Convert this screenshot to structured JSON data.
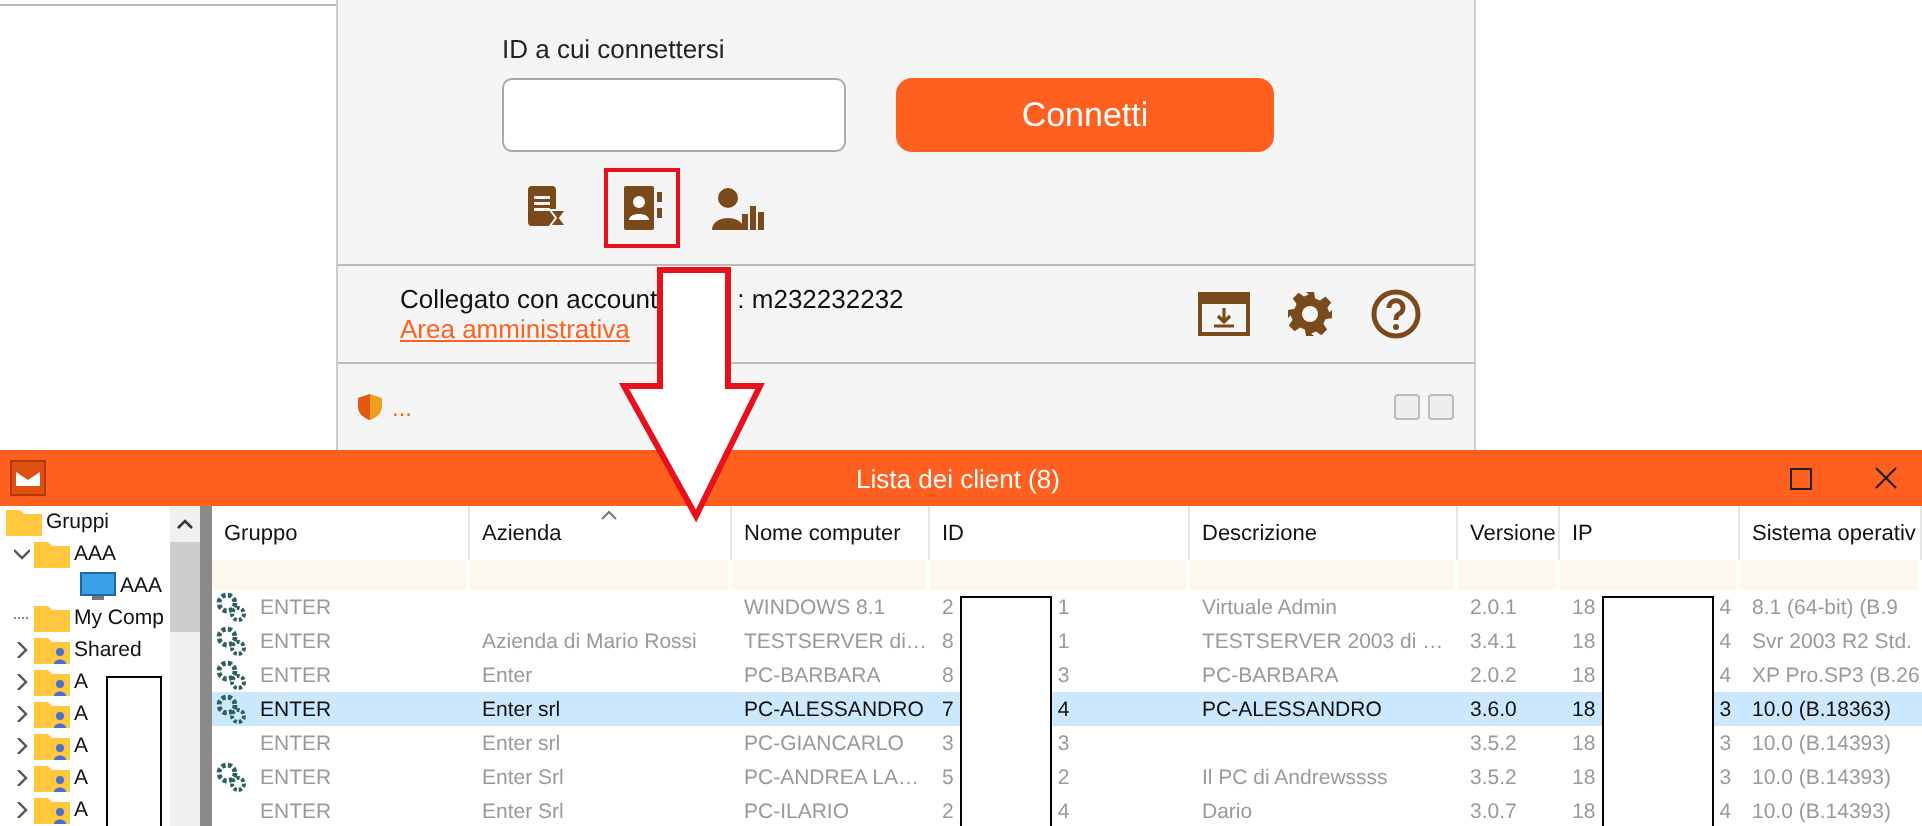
{
  "connect_panel": {
    "id_label": "ID a cui connettersi",
    "connect_button": "Connetti",
    "tools": [
      {
        "kind": "history",
        "highlighted": false
      },
      {
        "kind": "address-book",
        "highlighted": true
      },
      {
        "kind": "user-stats",
        "highlighted": false
      }
    ],
    "account_label": "Collegato con account",
    "account_id": ": m232232232",
    "admin_link": "Area amministrativa",
    "status_text": "..."
  },
  "client_list": {
    "title": "Lista dei client (8)",
    "tree": [
      {
        "label": "Gruppi",
        "kind": "folder",
        "children": [
          {
            "label": "AAA",
            "kind": "folder",
            "expanded": true,
            "children": [
              {
                "label": "AAA",
                "kind": "computer"
              }
            ]
          },
          {
            "label": "My Comp",
            "kind": "folder"
          },
          {
            "label": "Shared",
            "kind": "shared",
            "expanded": false
          },
          {
            "label": "A",
            "kind": "shared",
            "expanded": false
          },
          {
            "label": "A",
            "kind": "shared",
            "expanded": false
          },
          {
            "label": "A",
            "kind": "shared",
            "expanded": false
          },
          {
            "label": "A",
            "kind": "shared",
            "expanded": false
          },
          {
            "label": "A",
            "kind": "shared",
            "expanded": false
          }
        ]
      }
    ],
    "columns": [
      {
        "label": "Gruppo",
        "sorted": false
      },
      {
        "label": "Azienda",
        "sorted": true
      },
      {
        "label": "Nome computer",
        "sorted": false
      },
      {
        "label": "ID",
        "sorted": false
      },
      {
        "label": "Descrizione",
        "sorted": false
      },
      {
        "label": "Versione",
        "sorted": false
      },
      {
        "label": "IP",
        "sorted": false
      },
      {
        "label": "Sistema operativ",
        "sorted": false
      }
    ],
    "rows": [
      {
        "icon": true,
        "active": false,
        "selected": false,
        "group": "ENTER",
        "computer": "WINDOWS 8.1",
        "id_start": "2",
        "id_end": "1",
        "description": "Virtuale Admin",
        "version": "2.0.1",
        "ip_start": "18",
        "ip_end": "4",
        "os": "8.1  (64-bit) (B.9"
      },
      {
        "icon": true,
        "active": false,
        "selected": false,
        "group": "ENTER",
        "company": "Azienda di Mario Rossi",
        "computer": "TESTSERVER di…",
        "id_start": "8",
        "id_end": "1",
        "description": "TESTSERVER 2003 di …",
        "version": "3.4.1",
        "ip_start": "18",
        "ip_end": "4",
        "os": "Svr 2003 R2 Std."
      },
      {
        "icon": true,
        "active": false,
        "selected": false,
        "group": "ENTER",
        "company": "Enter",
        "computer": "PC-BARBARA",
        "id_start": "8",
        "id_end": "3",
        "description": "PC-BARBARA",
        "version": "2.0.2",
        "ip_start": "18",
        "ip_end": "4",
        "os": "XP Pro.SP3 (B.26"
      },
      {
        "icon": true,
        "active": true,
        "selected": true,
        "group": "ENTER",
        "company": "Enter srl",
        "computer": "PC-ALESSANDRO",
        "id_start": "7",
        "id_end": "4",
        "description": "PC-ALESSANDRO",
        "version": "3.6.0",
        "ip_start": "18",
        "ip_end": "3",
        "os": "10.0 (B.18363)"
      },
      {
        "icon": false,
        "active": false,
        "selected": false,
        "group": "ENTER",
        "company": "Enter srl",
        "computer": "PC-GIANCARLO",
        "id_start": "3",
        "id_end": "3",
        "version": "3.5.2",
        "ip_start": "18",
        "ip_end": "3",
        "os": "10.0 (B.14393)"
      },
      {
        "icon": true,
        "active": false,
        "selected": false,
        "group": "ENTER",
        "company": "Enter Srl",
        "computer": "PC-ANDREA LA…",
        "id_start": "5",
        "id_end": "2",
        "description": "Il PC di Andrewssss",
        "version": "3.5.2",
        "ip_start": "18",
        "ip_end": "3",
        "os": "10.0 (B.14393)"
      },
      {
        "icon": false,
        "active": false,
        "selected": false,
        "group": "ENTER",
        "company": "Enter Srl",
        "computer": "PC-ILARIO",
        "id_start": "2",
        "id_end": "4",
        "description": "Dario",
        "version": "3.0.7",
        "ip_start": "18",
        "ip_end": "4",
        "os": "10.0 (B.14393)"
      }
    ]
  }
}
